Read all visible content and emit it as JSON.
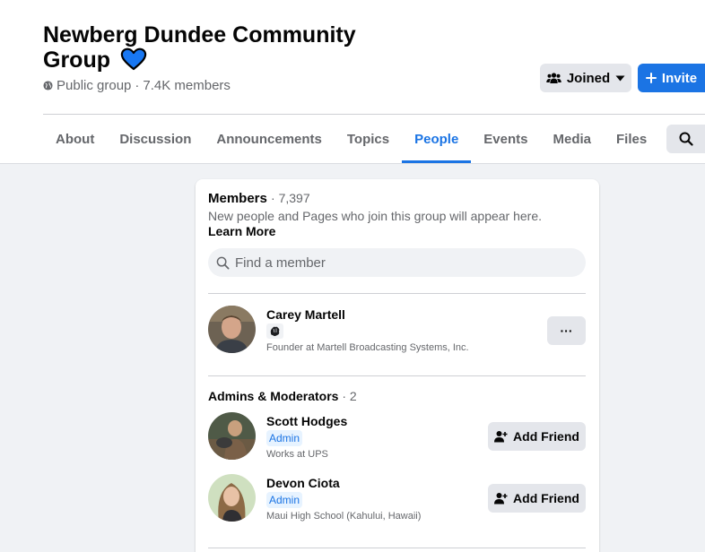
{
  "group": {
    "title": "Newberg Dundee Community Group",
    "privacy": "Public group",
    "separator": "·",
    "members_short": "7.4K members"
  },
  "actions": {
    "joined_label": "Joined",
    "invite_label": "Invite"
  },
  "tabs": [
    {
      "label": "About"
    },
    {
      "label": "Discussion"
    },
    {
      "label": "Announcements"
    },
    {
      "label": "Topics"
    },
    {
      "label": "People",
      "active": true
    },
    {
      "label": "Events"
    },
    {
      "label": "Media"
    },
    {
      "label": "Files"
    }
  ],
  "members": {
    "title": "Members",
    "count": "· 7,397",
    "description": "New people and Pages who join this group will appear here.",
    "learn_more": "Learn More",
    "search_placeholder": "Find a member"
  },
  "founder": {
    "name": "Carey Martell",
    "subtitle": "Founder at Martell Broadcasting Systems, Inc.",
    "more_label": "···"
  },
  "admins": {
    "title": "Admins & Moderators",
    "count": "· 2",
    "people": [
      {
        "name": "Scott Hodges",
        "badge": "Admin",
        "subtitle": "Works at UPS",
        "action": "Add Friend"
      },
      {
        "name": "Devon Ciota",
        "badge": "Admin",
        "subtitle": "Maui High School (Kahului, Hawaii)",
        "action": "Add Friend"
      }
    ]
  },
  "colors": {
    "accent": "#1b74e4",
    "background": "#f0f2f5",
    "button_gray": "#e4e6eb",
    "heart": "#1877f2"
  }
}
